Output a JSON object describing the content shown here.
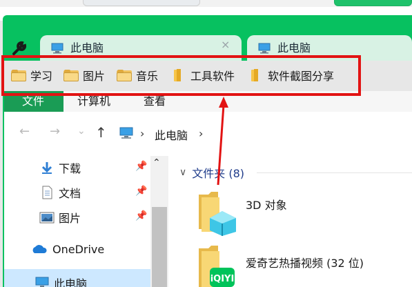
{
  "tabs": [
    {
      "label": "此电脑",
      "close": "×"
    },
    {
      "label": "此电脑"
    }
  ],
  "bookmarks": [
    {
      "label": "学习",
      "icon": "folder-icon"
    },
    {
      "label": "图片",
      "icon": "folder-icon"
    },
    {
      "label": "音乐",
      "icon": "folder-icon"
    },
    {
      "label": "工具软件",
      "icon": "folder-icon"
    },
    {
      "label": "软件截图分享",
      "icon": "folder-icon"
    }
  ],
  "ribbon": {
    "file": "文件",
    "computer": "计算机",
    "view": "查看"
  },
  "address": {
    "back": "←",
    "forward": "→",
    "recent": "⌄",
    "up": "↑",
    "separator": "›",
    "location": "此电脑"
  },
  "nav": [
    {
      "label": "下载",
      "icon": "download-icon",
      "pinned": true
    },
    {
      "label": "文档",
      "icon": "document-icon",
      "pinned": true
    },
    {
      "label": "图片",
      "icon": "pictures-icon",
      "pinned": true
    },
    {
      "label": "OneDrive",
      "icon": "onedrive-icon",
      "pinned": false
    },
    {
      "label": "此电脑",
      "icon": "pc-icon",
      "pinned": false
    }
  ],
  "content": {
    "group": {
      "label": "文件夹 (8)"
    },
    "items": [
      {
        "label": "3D 对象",
        "icon": "3d-objects-folder-icon"
      },
      {
        "label": "爱奇艺热播视频 (32 位)",
        "icon": "iqiyi-folder-icon"
      }
    ]
  },
  "colors": {
    "frame": "#07c160",
    "highlight": "#e21313",
    "file_tab": "#1a9c55",
    "tab_bg": "#d8f2e4"
  }
}
